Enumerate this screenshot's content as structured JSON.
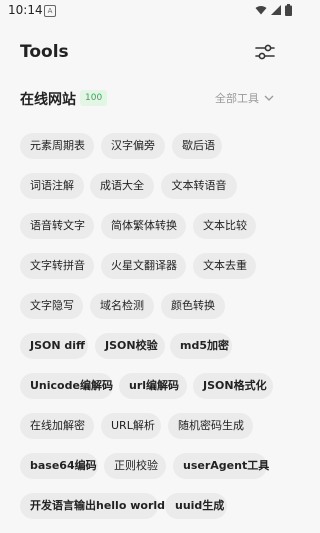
{
  "status": {
    "time": "10:14",
    "notif_letter": "A"
  },
  "header": {
    "title": "Tools"
  },
  "section": {
    "title": "在线网站",
    "count": "100",
    "all_label": "全部工具"
  },
  "tools": [
    "元素周期表",
    "汉字偏旁",
    "歇后语",
    "词语注解",
    "成语大全",
    "文本转语音",
    "语音转文字",
    "简体繁体转换",
    "文本比较",
    "文字转拼音",
    "火星文翻译器",
    "文本去重",
    "文字隐写",
    "域名检测",
    "颜色转换",
    "JSON diff",
    "JSON校验",
    "md5加密",
    "Unicode编解码",
    "url编解码",
    "JSON格式化",
    "在线加解密",
    "URL解析",
    "随机密码生成",
    "base64编码",
    "正则校验",
    "userAgent工具",
    "开发语言输出hello world",
    "uuid生成"
  ],
  "icons": {
    "filter": "sliders-icon",
    "chevron": "chevron-down-icon",
    "wifi": "wifi-icon",
    "signal": "signal-icon",
    "battery": "battery-icon"
  },
  "colors": {
    "badge_bg": "#e3f5e5",
    "badge_text": "#3aa65a",
    "chip_bg": "#ebebeb"
  }
}
